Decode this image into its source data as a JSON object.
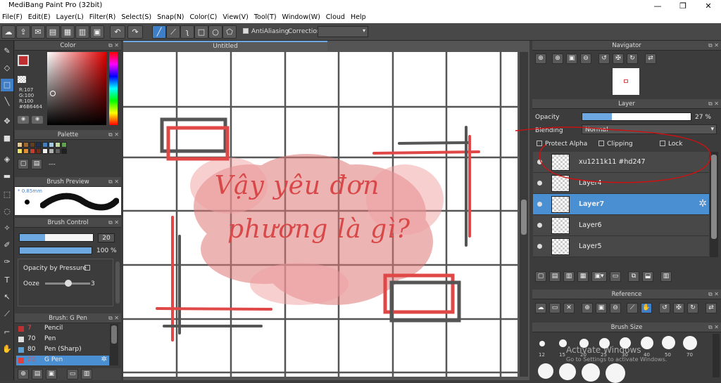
{
  "app": {
    "title": "MediBang Paint Pro (32bit)"
  },
  "window_controls": [
    "—",
    "❐",
    "✕"
  ],
  "menu": [
    "File(F)",
    "Edit(E)",
    "Layer(L)",
    "Filter(R)",
    "Select(S)",
    "Snap(N)",
    "Color(C)",
    "View(V)",
    "Tool(T)",
    "Window(W)",
    "Cloud",
    "Help"
  ],
  "toolbar": {
    "antialiasing_label": "AntiAliasing",
    "correction_label": "Correction"
  },
  "color_panel": {
    "title": "Color",
    "r": "R:107",
    "g": "G:100",
    "b": "R:100",
    "hex": "#6B6464",
    "primary_color": "#c03030"
  },
  "palette_panel": {
    "title": "Palette",
    "dash": "---",
    "swatches": [
      "#e8c890",
      "#a06830",
      "#604020",
      "#203050",
      "#4080c0",
      "#a0c8e0",
      "#c0d8a0",
      "#60a050",
      "#f0e060",
      "#e09030",
      "#c04030",
      "#703020",
      "#f0f0f0",
      "#b0b0b0",
      "#606060",
      "#202020"
    ]
  },
  "brush_preview": {
    "title": "Brush Preview",
    "size_label": "* 0.85mm"
  },
  "brush_control": {
    "title": "Brush Control",
    "size_value": "20",
    "opacity_value": "100 %",
    "opacity_pressure_label": "Opacity by Pressure",
    "ooze_label": "Ooze",
    "ooze_value": "3",
    "size_fill": 0.35,
    "opacity_fill": 1.0
  },
  "brush_list": {
    "title": "Brush: G Pen",
    "items": [
      {
        "size": "7",
        "name": "Pencil",
        "color": "#c03030"
      },
      {
        "size": "70",
        "name": "Pen",
        "color": "#e0e0e0"
      },
      {
        "size": "80",
        "name": "Pen (Sharp)",
        "color": "#60a0d0"
      },
      {
        "size": "20",
        "name": "G Pen",
        "color": "#e04040"
      }
    ]
  },
  "canvas": {
    "tab_title": "Untitled",
    "text_line1": "Vậy yêu đơn",
    "text_line2": "phương là gì?"
  },
  "navigator": {
    "title": "Navigator"
  },
  "layer_panel": {
    "title": "Layer",
    "opacity_label": "Opacity",
    "opacity_value": "27 %",
    "opacity_fill": 0.27,
    "blending_label": "Blending",
    "blending_value": "Normal",
    "protect_alpha_label": "Protect Alpha",
    "clipping_label": "Clipping",
    "lock_label": "Lock",
    "layers": [
      {
        "name": "xu1211k11 #hd247"
      },
      {
        "name": "Layer4"
      },
      {
        "name": "Layer7"
      },
      {
        "name": "Layer6"
      },
      {
        "name": "Layer5"
      }
    ]
  },
  "reference_panel": {
    "title": "Reference"
  },
  "brush_size_panel": {
    "title": "Brush Size",
    "sizes": [
      "12",
      "15",
      "20",
      "25",
      "30",
      "40",
      "50",
      "70"
    ]
  },
  "watermark": {
    "line1": "Activate Windows",
    "line2": "Go to Settings to activate Windows."
  }
}
